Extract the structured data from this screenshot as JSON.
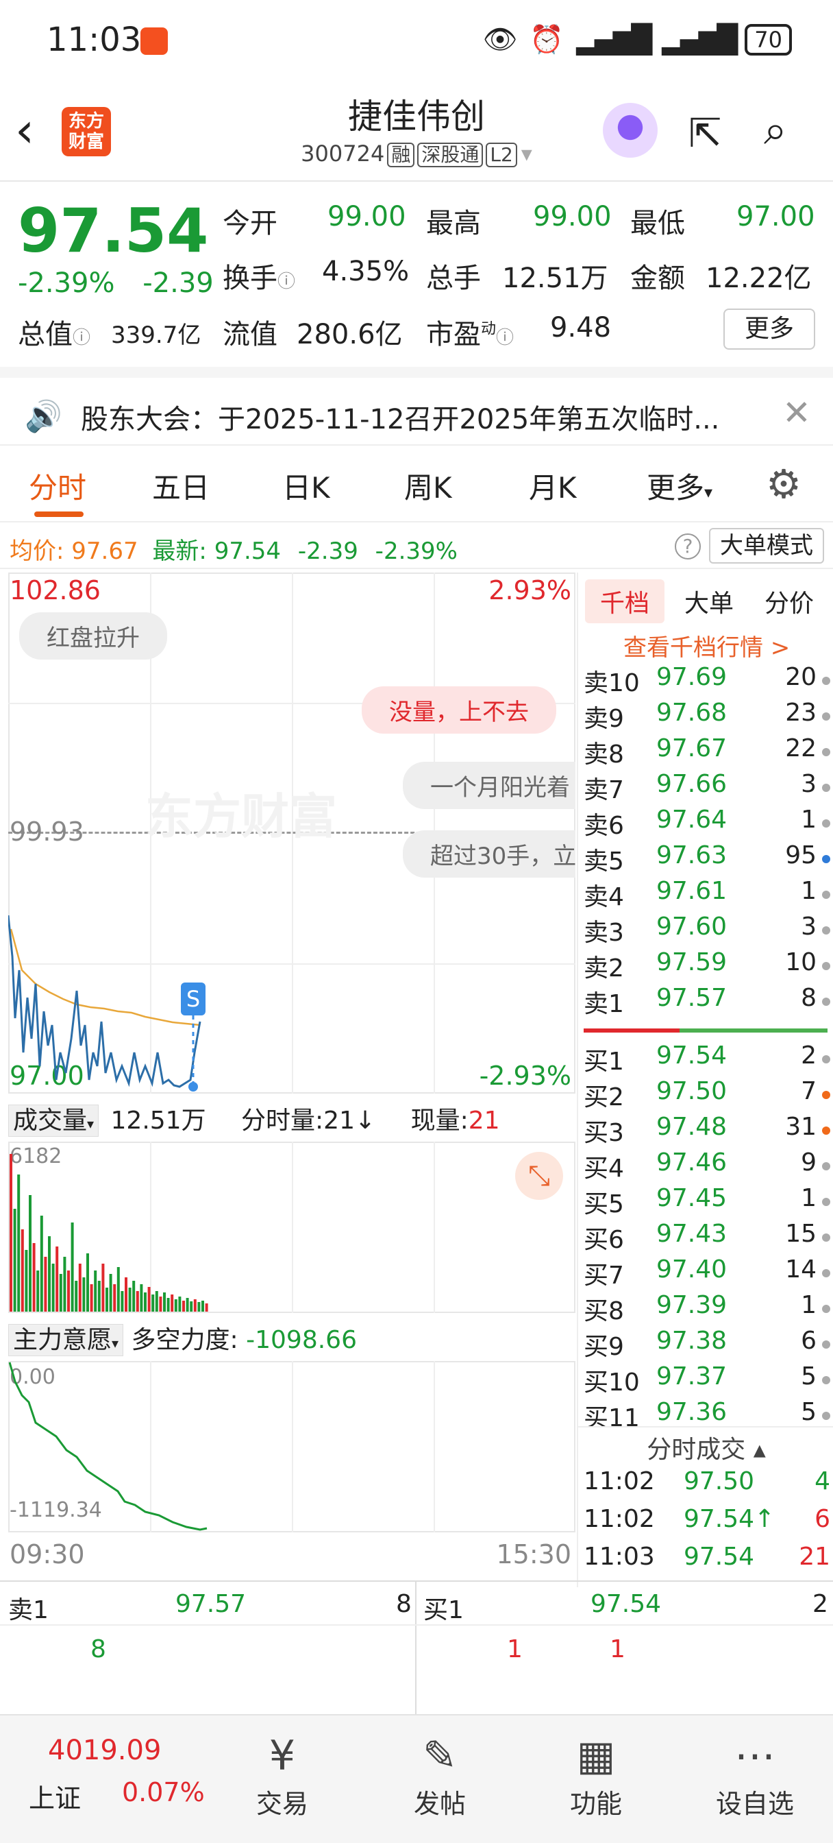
{
  "status_bar": {
    "time": "11:03",
    "battery": "70"
  },
  "header": {
    "title": "捷佳伟创",
    "code": "300724",
    "tags": [
      "融",
      "深股通",
      "L2"
    ],
    "logo_text": [
      "东方",
      "财富"
    ]
  },
  "quote": {
    "price": "97.54",
    "change_pct": "-2.39%",
    "change": "-2.39",
    "open_label": "今开",
    "open": "99.00",
    "high_label": "最高",
    "high": "99.00",
    "low_label": "最低",
    "low": "97.00",
    "turnover_label": "换手",
    "turnover": "4.35%",
    "volume_label": "总手",
    "volume": "12.51万",
    "amount_label": "金额",
    "amount": "12.22亿",
    "mktcap_label": "总值",
    "mktcap": "339.7亿",
    "float_label": "流值",
    "float": "280.6亿",
    "pe_label": "市盈",
    "pe_sup": "动",
    "pe": "9.48",
    "more": "更多"
  },
  "notice": {
    "text": "股东大会：于2025-11-12召开2025年第五次临时..."
  },
  "tabs": {
    "items": [
      "分时",
      "五日",
      "日K",
      "周K",
      "月K",
      "更多"
    ],
    "active": "分时"
  },
  "info": {
    "avg_label": "均价:",
    "avg": "97.67",
    "last_label": "最新:",
    "last": "97.54",
    "chg": "-2.39",
    "chg_pct": "-2.39%",
    "help": "?",
    "mode": "大单模式"
  },
  "chart": {
    "y_top": "102.86",
    "y_top_pct": "2.93%",
    "y_mid": "99.93",
    "y_bot": "97.00",
    "y_bot_pct": "-2.93%",
    "pills": [
      "红盘拉升",
      "没量，上不去",
      "一个月阳光着",
      "超过30手，立"
    ],
    "watermark": "东方财富",
    "signal": "S",
    "volume_label": "成交量",
    "volume_total": "12.51万",
    "tick_label": "分时量:21↓",
    "now_label": "现量:",
    "now_val": "21",
    "vol_max": "6182",
    "ind_label": "主力意愿",
    "ind_name": "多空力度:",
    "ind_val": "-1098.66",
    "ind_top": "0.00",
    "ind_bot": "-1119.34",
    "time_start": "09:30",
    "time_end": "15:30"
  },
  "book": {
    "tabs": [
      "千档",
      "大单",
      "分价"
    ],
    "link": "查看千档行情 >",
    "asks": [
      {
        "label": "卖10",
        "price": "97.69",
        "vol": "20"
      },
      {
        "label": "卖9",
        "price": "97.68",
        "vol": "23"
      },
      {
        "label": "卖8",
        "price": "97.67",
        "vol": "22"
      },
      {
        "label": "卖7",
        "price": "97.66",
        "vol": "3"
      },
      {
        "label": "卖6",
        "price": "97.64",
        "vol": "1"
      },
      {
        "label": "卖5",
        "price": "97.63",
        "vol": "95"
      },
      {
        "label": "卖4",
        "price": "97.61",
        "vol": "1"
      },
      {
        "label": "卖3",
        "price": "97.60",
        "vol": "3"
      },
      {
        "label": "卖2",
        "price": "97.59",
        "vol": "10"
      },
      {
        "label": "卖1",
        "price": "97.57",
        "vol": "8"
      }
    ],
    "bids": [
      {
        "label": "买1",
        "price": "97.54",
        "vol": "2"
      },
      {
        "label": "买2",
        "price": "97.50",
        "vol": "7"
      },
      {
        "label": "买3",
        "price": "97.48",
        "vol": "31"
      },
      {
        "label": "买4",
        "price": "97.46",
        "vol": "9"
      },
      {
        "label": "买5",
        "price": "97.45",
        "vol": "1"
      },
      {
        "label": "买6",
        "price": "97.43",
        "vol": "15"
      },
      {
        "label": "买7",
        "price": "97.40",
        "vol": "14"
      },
      {
        "label": "买8",
        "price": "97.39",
        "vol": "1"
      },
      {
        "label": "买9",
        "price": "97.38",
        "vol": "6"
      },
      {
        "label": "买10",
        "price": "97.37",
        "vol": "5"
      },
      {
        "label": "买11",
        "price": "97.36",
        "vol": "5"
      }
    ],
    "trades_title": "分时成交",
    "trades": [
      {
        "time": "11:02",
        "price": "97.50",
        "vol": "4"
      },
      {
        "time": "11:02",
        "price": "97.54↑",
        "vol": "6"
      },
      {
        "time": "11:03",
        "price": "97.54",
        "vol": "21"
      }
    ]
  },
  "strip": {
    "ask_label": "卖1",
    "ask_price": "97.57",
    "ask_vol": "8",
    "bid_label": "买1",
    "bid_price": "97.54",
    "bid_vol": "2",
    "ask_q1": "8",
    "bid_q1": "1",
    "bid_q2": "1"
  },
  "nav": {
    "index_val": "4019.09",
    "index_name": "上证",
    "index_pct": "0.07%",
    "items": [
      "交易",
      "发帖",
      "功能",
      "设自选"
    ]
  },
  "colors": {
    "up": "#e0282d",
    "down": "#1a9a35",
    "accent": "#e85a14"
  }
}
